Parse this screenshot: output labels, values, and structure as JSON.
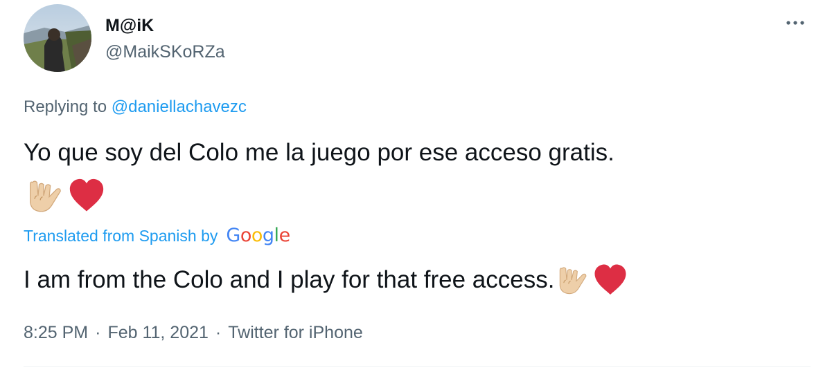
{
  "user": {
    "display_name": "M@iK",
    "handle": "@MaikSKoRZa"
  },
  "more_icon": "more-horizontal-icon",
  "reply": {
    "prefix": "Replying to",
    "mention": "@daniellachavezc"
  },
  "tweet": {
    "text": "Yo que soy del Colo me la juego por ese acceso gratis.",
    "emojis": [
      "love-you-gesture-icon",
      "red-heart-icon"
    ]
  },
  "translation": {
    "label": "Translated from Spanish by",
    "provider": "Google",
    "text": "I am from the Colo and I play for that free access."
  },
  "meta": {
    "time": "8:25 PM",
    "date": "Feb 11, 2021",
    "source": "Twitter for iPhone",
    "separator": "·"
  },
  "colors": {
    "link": "#1d9bf0",
    "secondary_text": "#536471",
    "primary_text": "#0f1419",
    "heart": "#dd2e44",
    "google_blue": "#4285f4",
    "google_red": "#ea4335",
    "google_yellow": "#fbbc05",
    "google_green": "#34a853"
  }
}
